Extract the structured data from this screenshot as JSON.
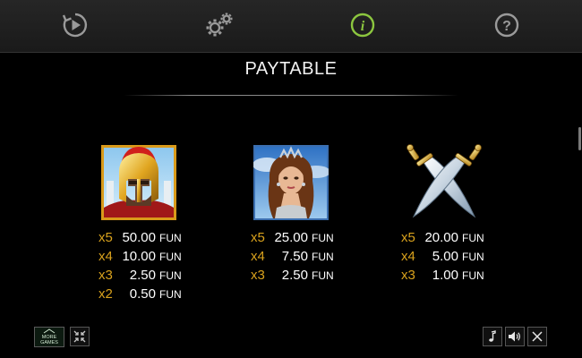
{
  "topbar": {
    "buttons": [
      {
        "name": "autoplay-icon",
        "active": false
      },
      {
        "name": "settings-gears-icon",
        "active": false
      },
      {
        "name": "info-icon",
        "active": true
      },
      {
        "name": "help-icon",
        "active": false
      }
    ],
    "active_color": "#8cc63f",
    "inactive_color": "#9a9a9a"
  },
  "paytable": {
    "title": "PAYTABLE",
    "symbols": [
      {
        "name": "spartan-warrior",
        "rows": [
          {
            "mult": "x5",
            "amount": "50.00",
            "unit": "FUN"
          },
          {
            "mult": "x4",
            "amount": "10.00",
            "unit": "FUN"
          },
          {
            "mult": "x3",
            "amount": "2.50",
            "unit": "FUN"
          },
          {
            "mult": "x2",
            "amount": "0.50",
            "unit": "FUN"
          }
        ]
      },
      {
        "name": "goddess",
        "rows": [
          {
            "mult": "x5",
            "amount": "25.00",
            "unit": "FUN"
          },
          {
            "mult": "x4",
            "amount": "7.50",
            "unit": "FUN"
          },
          {
            "mult": "x3",
            "amount": "2.50",
            "unit": "FUN"
          }
        ]
      },
      {
        "name": "crossed-swords",
        "rows": [
          {
            "mult": "x5",
            "amount": "20.00",
            "unit": "FUN"
          },
          {
            "mult": "x4",
            "amount": "5.00",
            "unit": "FUN"
          },
          {
            "mult": "x3",
            "amount": "1.00",
            "unit": "FUN"
          }
        ]
      }
    ],
    "multiplier_color": "#d9a21d"
  },
  "bottombar": {
    "more_games_line1": "MORE",
    "more_games_line2": "GAMES",
    "buttons": [
      "collapse-icon",
      "music-note-icon",
      "speaker-icon",
      "close-icon"
    ]
  }
}
